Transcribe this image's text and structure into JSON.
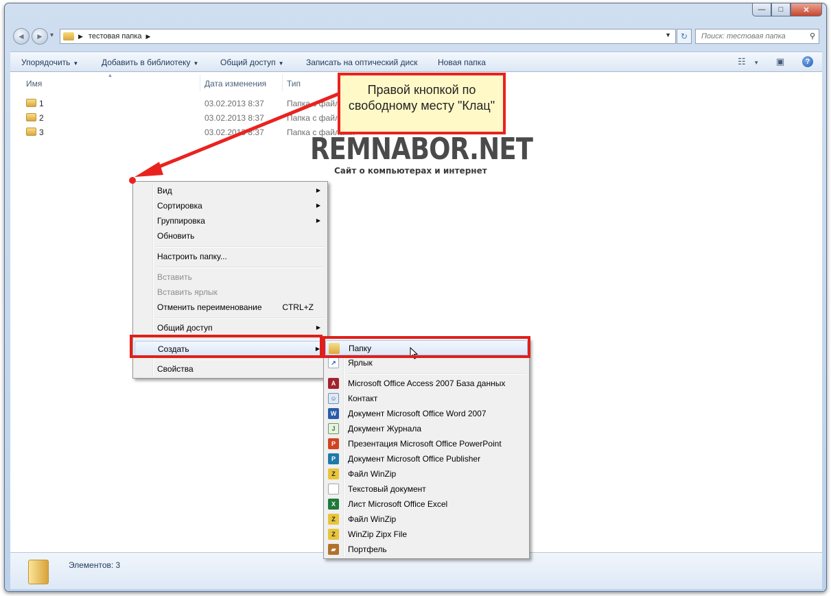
{
  "window": {
    "controls": {
      "minimize": "—",
      "maximize": "□",
      "close": "✕"
    }
  },
  "nav": {
    "back": "◄",
    "forward": "►",
    "history": "▾",
    "breadcrumb": "тестовая папка",
    "search_placeholder": "Поиск: тестовая папка"
  },
  "toolbar": {
    "organize": "Упорядочить",
    "add_to_library": "Добавить в библиотеку",
    "share": "Общий доступ",
    "burn": "Записать на оптический диск",
    "new_folder": "Новая папка",
    "help": "?"
  },
  "columns": {
    "name": "Имя",
    "date": "Дата изменения",
    "type": "Тип"
  },
  "files": [
    {
      "name": "1",
      "date": "03.02.2013 8:37",
      "type": "Папка с файлами"
    },
    {
      "name": "2",
      "date": "03.02.2013 8:37",
      "type": "Папка с файлами"
    },
    {
      "name": "3",
      "date": "03.02.2013 8:37",
      "type": "Папка с файлами"
    }
  ],
  "status": {
    "items_count": "Элементов: 3"
  },
  "context_menu": {
    "items": [
      {
        "label": "Вид",
        "submenu": true
      },
      {
        "label": "Сортировка",
        "submenu": true
      },
      {
        "label": "Группировка",
        "submenu": true
      },
      {
        "label": "Обновить"
      },
      {
        "label": "Настроить папку..."
      },
      {
        "label": "Вставить",
        "disabled": true
      },
      {
        "label": "Вставить ярлык",
        "disabled": true
      },
      {
        "label": "Отменить переименование",
        "shortcut": "CTRL+Z"
      },
      {
        "label": "Общий доступ",
        "submenu": true
      },
      {
        "label": "Создать",
        "submenu": true,
        "highlighted": true
      },
      {
        "label": "Свойства"
      }
    ]
  },
  "create_submenu": {
    "items": [
      {
        "label": "Папку",
        "icon": "folder-icon",
        "highlighted": true
      },
      {
        "label": "Ярлык",
        "icon": "shortcut-icon"
      },
      {
        "label": "Microsoft Office Access 2007 База данных",
        "icon": "access-icon"
      },
      {
        "label": "Контакт",
        "icon": "contact-icon"
      },
      {
        "label": "Документ Microsoft Office Word 2007",
        "icon": "word-icon"
      },
      {
        "label": "Документ Журнала",
        "icon": "journal-icon"
      },
      {
        "label": "Презентация Microsoft Office PowerPoint",
        "icon": "powerpoint-icon"
      },
      {
        "label": "Документ Microsoft Office Publisher",
        "icon": "publisher-icon"
      },
      {
        "label": "Файл WinZip",
        "icon": "winzip-icon"
      },
      {
        "label": "Текстовый документ",
        "icon": "text-document-icon"
      },
      {
        "label": "Лист Microsoft Office Excel",
        "icon": "excel-icon"
      },
      {
        "label": "Файл WinZip",
        "icon": "winzip-icon"
      },
      {
        "label": "WinZip Zipx File",
        "icon": "winzip-icon"
      },
      {
        "label": "Портфель",
        "icon": "briefcase-icon"
      }
    ]
  },
  "annotation": {
    "callout_text": "Правой кнопкой по свободному месту \"Клац\"",
    "watermark": "REMNABOR.NET",
    "watermark_subtitle": "Сайт о компьютерах и интернет",
    "accent_color": "#e8231f"
  }
}
